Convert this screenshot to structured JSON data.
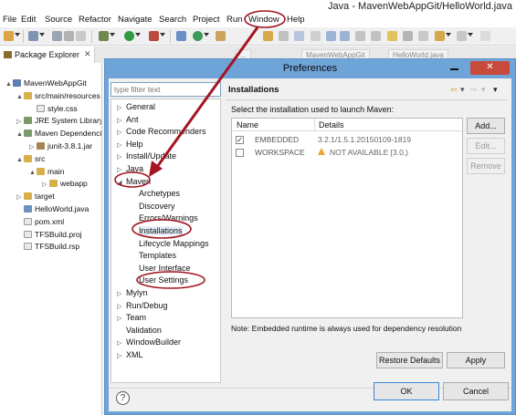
{
  "window": {
    "title": "Java - MavenWebAppGit/HelloWorld.java"
  },
  "menubar": {
    "items": [
      "File",
      "Edit",
      "Source",
      "Refactor",
      "Navigate",
      "Search",
      "Project",
      "Run",
      "Window",
      "Help"
    ]
  },
  "explorer": {
    "tab_label": "Package Explorer",
    "close_glyph": "✕",
    "tree": [
      {
        "label": "MavenWebAppGit",
        "twisty": "▲",
        "icon": "proj"
      },
      {
        "label": "src/main/resources",
        "twisty": "▲",
        "icon": "fold"
      },
      {
        "label": "style.css",
        "twisty": "",
        "icon": "file"
      },
      {
        "label": "JRE System Library",
        "twisty": "▷",
        "icon": "lib"
      },
      {
        "label": "Maven Dependencies",
        "twisty": "▲",
        "icon": "lib"
      },
      {
        "label": "junit-3.8.1.jar",
        "twisty": "▷",
        "icon": "jar"
      },
      {
        "label": "src",
        "twisty": "▲",
        "icon": "fold"
      },
      {
        "label": "main",
        "twisty": "▲",
        "icon": "fold"
      },
      {
        "label": "webapp",
        "twisty": "▷",
        "icon": "fold"
      },
      {
        "label": "target",
        "twisty": "▷",
        "icon": "fold"
      },
      {
        "label": "HelloWorld.java",
        "twisty": "",
        "icon": "java"
      },
      {
        "label": "pom.xml",
        "twisty": "",
        "icon": "file"
      },
      {
        "label": "TFSBuild.proj",
        "twisty": "",
        "icon": "file"
      },
      {
        "label": "TFSBuild.rsp",
        "twisty": "",
        "icon": "file"
      }
    ]
  },
  "editor_tabs": [
    "...",
    "MavenWebAppGit",
    "HelloWorld.java"
  ],
  "dialog": {
    "title": "Preferences",
    "filter_placeholder": "type filter text",
    "close_glyph": "✕",
    "nav": [
      {
        "label": "General",
        "twisty": "▷"
      },
      {
        "label": "Ant",
        "twisty": "▷"
      },
      {
        "label": "Code Recommenders",
        "twisty": "▷"
      },
      {
        "label": "Help",
        "twisty": "▷"
      },
      {
        "label": "Install/Update",
        "twisty": "▷"
      },
      {
        "label": "Java",
        "twisty": "▷"
      },
      {
        "label": "Maven",
        "twisty": "◢"
      },
      {
        "label": "Archetypes",
        "twisty": ""
      },
      {
        "label": "Discovery",
        "twisty": ""
      },
      {
        "label": "Errors/Warnings",
        "twisty": ""
      },
      {
        "label": "Installations",
        "twisty": ""
      },
      {
        "label": "Lifecycle Mappings",
        "twisty": ""
      },
      {
        "label": "Templates",
        "twisty": ""
      },
      {
        "label": "User Interface",
        "twisty": ""
      },
      {
        "label": "User Settings",
        "twisty": ""
      },
      {
        "label": "Mylyn",
        "twisty": "▷"
      },
      {
        "label": "Run/Debug",
        "twisty": "▷"
      },
      {
        "label": "Team",
        "twisty": "▷"
      },
      {
        "label": "Validation",
        "twisty": ""
      },
      {
        "label": "WindowBuilder",
        "twisty": "▷"
      },
      {
        "label": "XML",
        "twisty": "▷"
      }
    ],
    "page_title": "Installations",
    "page_nav": {
      "back": "⇦",
      "back_menu": "▾",
      "forward": "⇨",
      "forward_menu": "▾",
      "menu": "▾"
    },
    "description": "Select the installation used to launch Maven:",
    "table": {
      "columns": [
        "Name",
        "Details"
      ],
      "rows": [
        {
          "checked": true,
          "check_glyph": "✓",
          "name": "EMBEDDED",
          "details": "3.2.1/1.5.1.20150109-1819",
          "warning": false
        },
        {
          "checked": false,
          "check_glyph": "",
          "name": "WORKSPACE",
          "details": "NOT AVAILABLE [3.0,)",
          "warning": true
        }
      ]
    },
    "buttons": {
      "add": "Add...",
      "edit": "Edit...",
      "remove": "Remove",
      "restore_defaults": "Restore Defaults",
      "apply": "Apply",
      "ok": "OK",
      "cancel": "Cancel"
    },
    "help_glyph": "?",
    "note": "Note: Embedded runtime is always used for dependency resolution"
  },
  "colors": {
    "dialog_frame": "#6fa4d9",
    "annotation": "#a31420",
    "close_button": "#c74a3c"
  }
}
